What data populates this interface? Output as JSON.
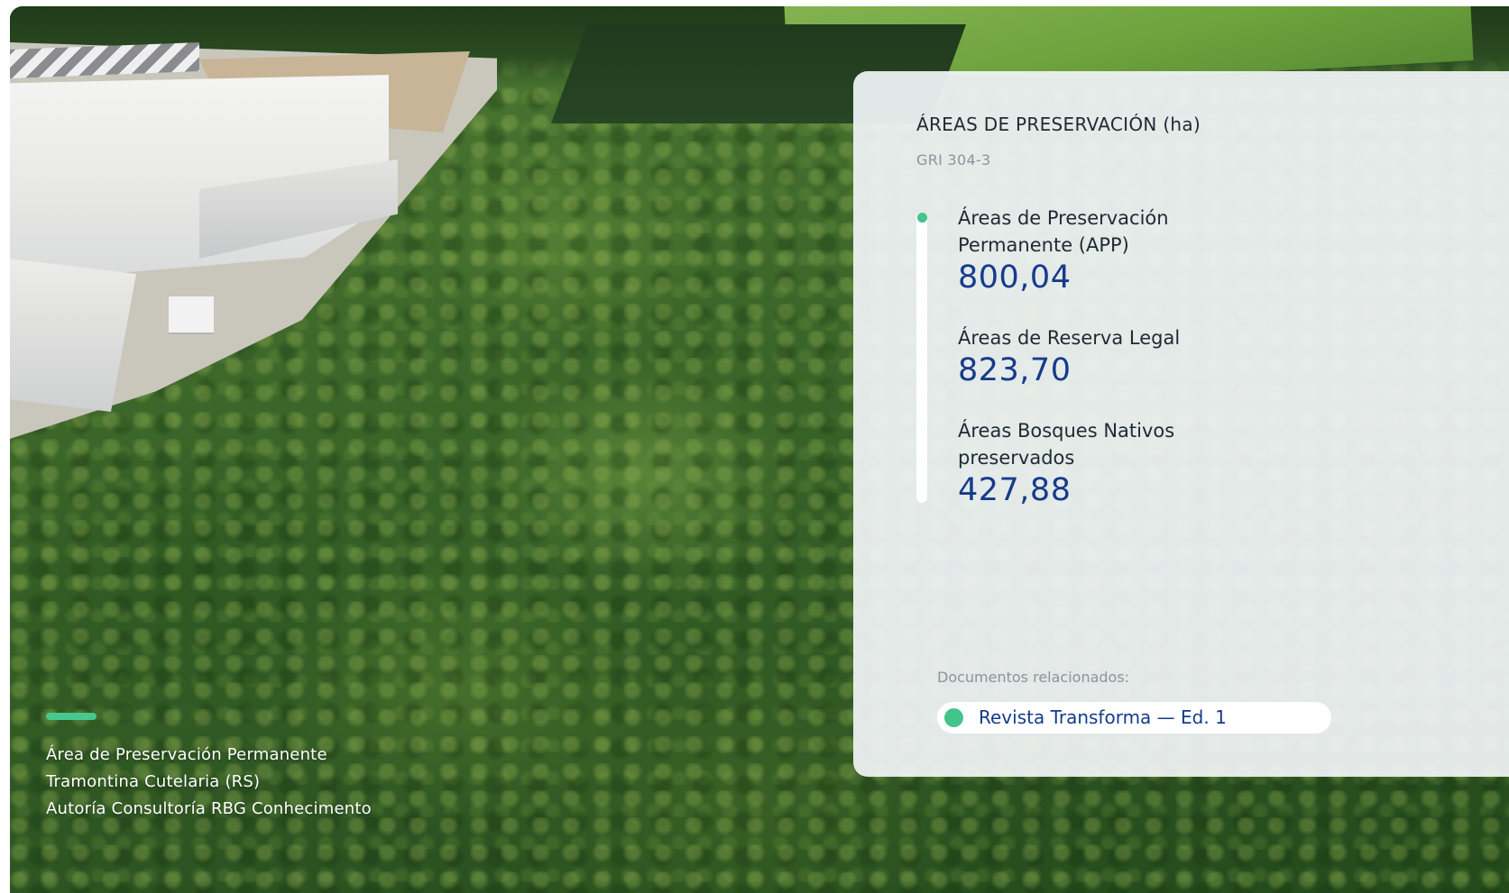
{
  "caption": {
    "lines": [
      "Área de Preservación Permanente",
      "Tramontina Cutelaria (RS)",
      "Autoría Consultoría RBG Conhecimento"
    ]
  },
  "panel": {
    "title": "ÁREAS DE PRESERVACIÓN (ha)",
    "subtitle": "GRI 304-3",
    "metrics": [
      {
        "label": "Áreas de Preservación Permanente (APP)",
        "value": "800,04"
      },
      {
        "label": "Áreas de Reserva Legal",
        "value": "823,70"
      },
      {
        "label": "Áreas Bosques Nativos preservados",
        "value": "427,88"
      }
    ],
    "related_label": "Documentos relacionados:",
    "related_link": "Revista Transforma — Ed. 1"
  },
  "colors": {
    "accent_green": "#43c48b",
    "value_blue": "#163b8c",
    "panel_bg": "#f1f4f6"
  },
  "icons": {
    "timeline_marker": "green-dot-icon",
    "document_marker": "green-dot-icon"
  }
}
